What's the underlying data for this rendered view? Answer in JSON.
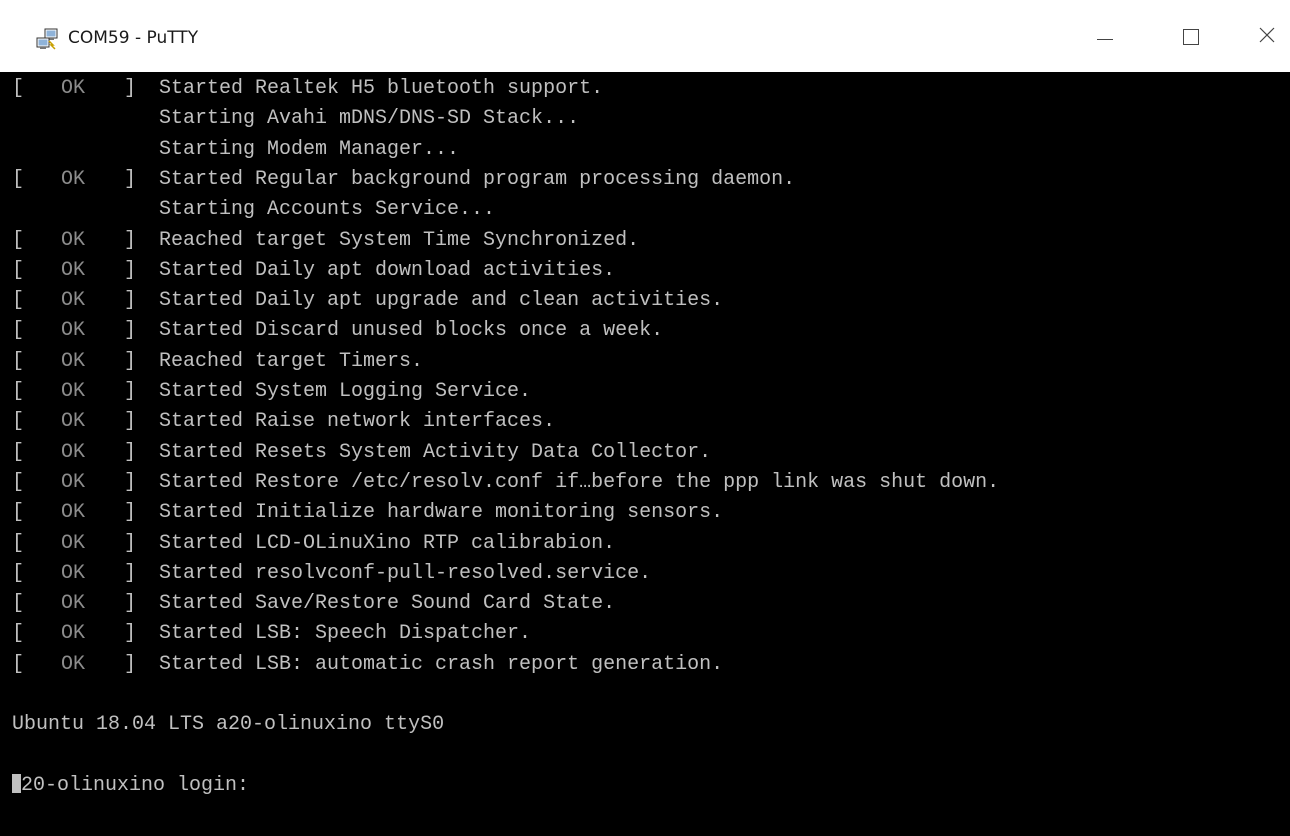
{
  "window": {
    "title": "COM59 - PuTTY",
    "icons": {
      "app": "putty-computers-icon",
      "minimize": "minimize-icon",
      "maximize": "maximize-icon",
      "close": "close-icon"
    }
  },
  "terminal": {
    "colors": {
      "background": "#000000",
      "foreground": "#c0c0c0",
      "ok_status": "#8c8c8c"
    },
    "ok_prefix_open": "[",
    "ok_word": "OK",
    "ok_prefix_close": "]",
    "lines": [
      {
        "status": "ok",
        "text": "Started Realtek H5 bluetooth support."
      },
      {
        "status": "none",
        "text": "Starting Avahi mDNS/DNS-SD Stack..."
      },
      {
        "status": "none",
        "text": "Starting Modem Manager..."
      },
      {
        "status": "ok",
        "text": "Started Regular background program processing daemon."
      },
      {
        "status": "none",
        "text": "Starting Accounts Service..."
      },
      {
        "status": "ok",
        "text": "Reached target System Time Synchronized."
      },
      {
        "status": "ok",
        "text": "Started Daily apt download activities."
      },
      {
        "status": "ok",
        "text": "Started Daily apt upgrade and clean activities."
      },
      {
        "status": "ok",
        "text": "Started Discard unused blocks once a week."
      },
      {
        "status": "ok",
        "text": "Reached target Timers."
      },
      {
        "status": "ok",
        "text": "Started System Logging Service."
      },
      {
        "status": "ok",
        "text": "Started Raise network interfaces."
      },
      {
        "status": "ok",
        "text": "Started Resets System Activity Data Collector."
      },
      {
        "status": "ok",
        "text": "Started Restore /etc/resolv.conf if…before the ppp link was shut down."
      },
      {
        "status": "ok",
        "text": "Started Initialize hardware monitoring sensors."
      },
      {
        "status": "ok",
        "text": "Started LCD-OLinuXino RTP calibrabion."
      },
      {
        "status": "ok",
        "text": "Started resolvconf-pull-resolved.service."
      },
      {
        "status": "ok",
        "text": "Started Save/Restore Sound Card State."
      },
      {
        "status": "ok",
        "text": "Started LSB: Speech Dispatcher."
      },
      {
        "status": "ok",
        "text": "Started LSB: automatic crash report generation."
      },
      {
        "status": "blank",
        "text": ""
      },
      {
        "status": "plain",
        "text": "Ubuntu 18.04 LTS a20-olinuxino ttyS0"
      },
      {
        "status": "blank",
        "text": ""
      },
      {
        "status": "prompt",
        "cursor_char": "a",
        "text": "20-olinuxino login:"
      }
    ]
  }
}
